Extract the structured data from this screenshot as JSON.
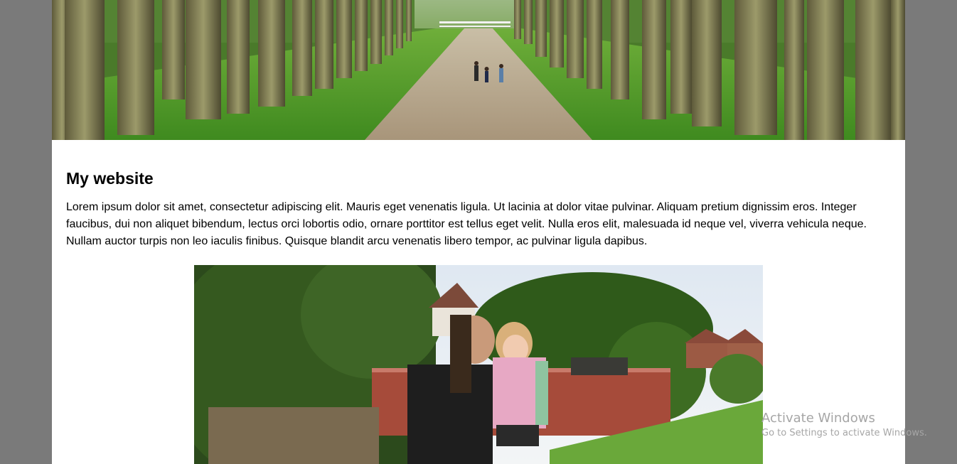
{
  "header": {
    "banner_image": "tree-lined-path-with-people"
  },
  "main": {
    "title": "My website",
    "intro": "Lorem ipsum dolor sit amet, consectetur adipiscing elit. Mauris eget venenatis ligula. Ut lacinia at dolor vitae pulvinar. Aliquam pretium dignissim eros. Integer faucibus, dui non aliquet bibendum, lectus orci lobortis odio, ornare porttitor est tellus eget velit. Nulla eros elit, malesuada id neque vel, viverra vehicula neque. Nullam auctor turpis non leo iaculis finibus. Quisque blandit arcu venenatis libero tempor, ac pulvinar ligula dapibus.",
    "photo": "man-holding-child-in-garden"
  },
  "watermark": {
    "line1": "Activate Windows",
    "line2": "Go to Settings to activate Windows."
  },
  "colors": {
    "background": "#7a7a7a",
    "page": "#ffffff",
    "text": "#000000"
  }
}
